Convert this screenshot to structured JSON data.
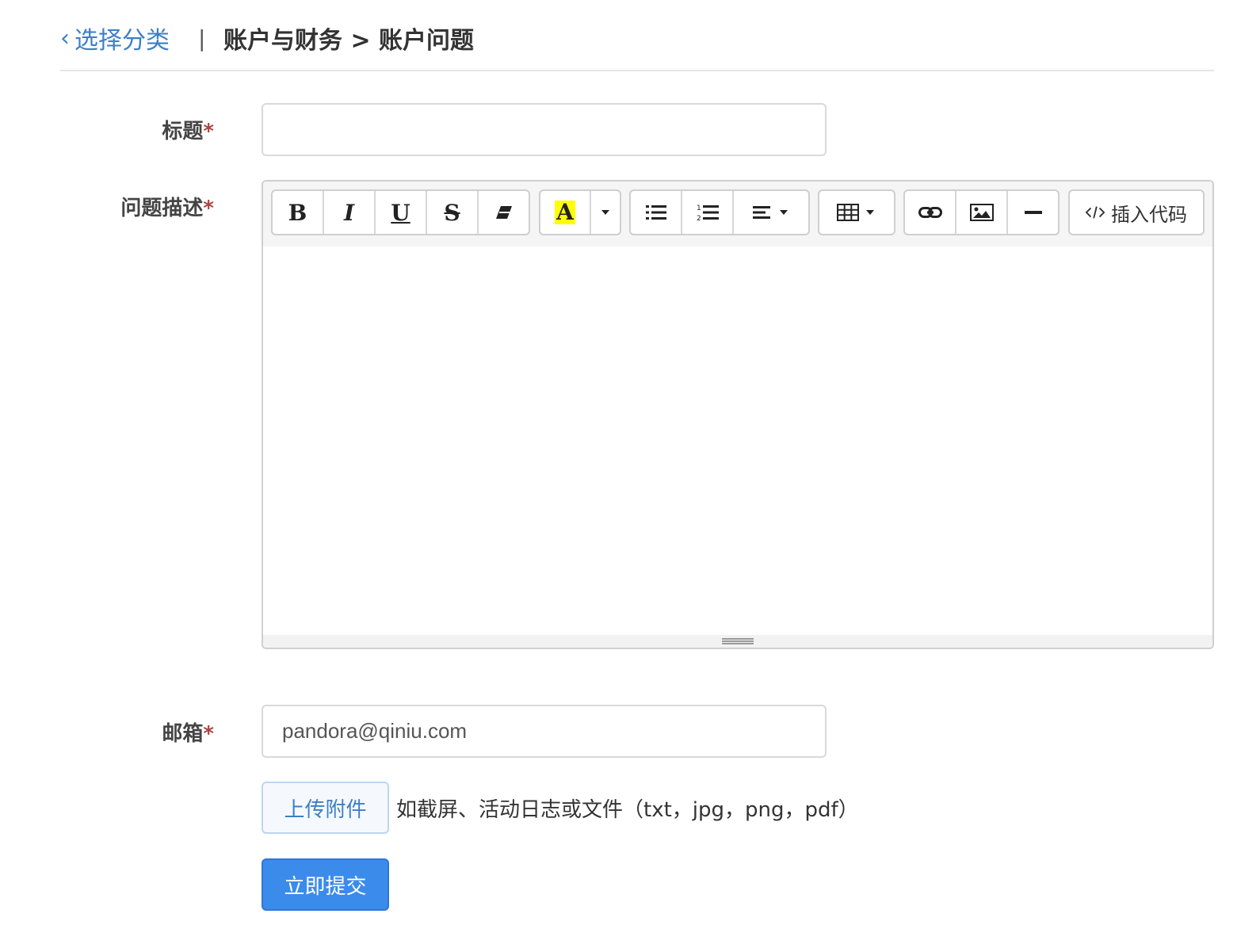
{
  "header": {
    "back_label": "选择分类",
    "separator": "|",
    "breadcrumb": "账户与财务 > 账户问题"
  },
  "form": {
    "title_label": "标题",
    "title_value": "",
    "description_label": "问题描述",
    "email_label": "邮箱",
    "email_value": "pandora@qiniu.com",
    "required_mark": "*"
  },
  "editor": {
    "toolbar": [
      {
        "name": "bold-button",
        "icon": "bold-icon"
      },
      {
        "name": "italic-button",
        "icon": "italic-icon"
      },
      {
        "name": "underline-button",
        "icon": "underline-icon"
      },
      {
        "name": "strikethrough-button",
        "icon": "strikethrough-icon"
      },
      {
        "name": "clear-format-button",
        "icon": "eraser-icon"
      },
      {
        "name": "highlight-color-button",
        "icon": "highlight-icon"
      },
      {
        "name": "color-dropdown-button",
        "icon": "caret-down-icon"
      },
      {
        "name": "bullet-list-button",
        "icon": "unordered-list-icon"
      },
      {
        "name": "numbered-list-button",
        "icon": "ordered-list-icon"
      },
      {
        "name": "align-button",
        "icon": "align-left-icon"
      },
      {
        "name": "table-button",
        "icon": "table-icon"
      },
      {
        "name": "link-button",
        "icon": "link-icon"
      },
      {
        "name": "image-button",
        "icon": "image-icon"
      },
      {
        "name": "horizontal-rule-button",
        "icon": "minus-icon"
      },
      {
        "name": "insert-code-button",
        "icon": "code-icon"
      }
    ],
    "glyphs": {
      "bold": "B",
      "italic": "I",
      "underline": "U",
      "strike": "S",
      "highlight": "A"
    },
    "insert_code_label": "插入代码",
    "highlight_color": "#ffff00"
  },
  "actions": {
    "upload_label": "上传附件",
    "upload_hint": "如截屏、活动日志或文件（txt，jpg，png，pdf）",
    "submit_label": "立即提交"
  },
  "colors": {
    "link": "#3d7fc6",
    "primary": "#3b8beb",
    "required": "#a94442"
  }
}
